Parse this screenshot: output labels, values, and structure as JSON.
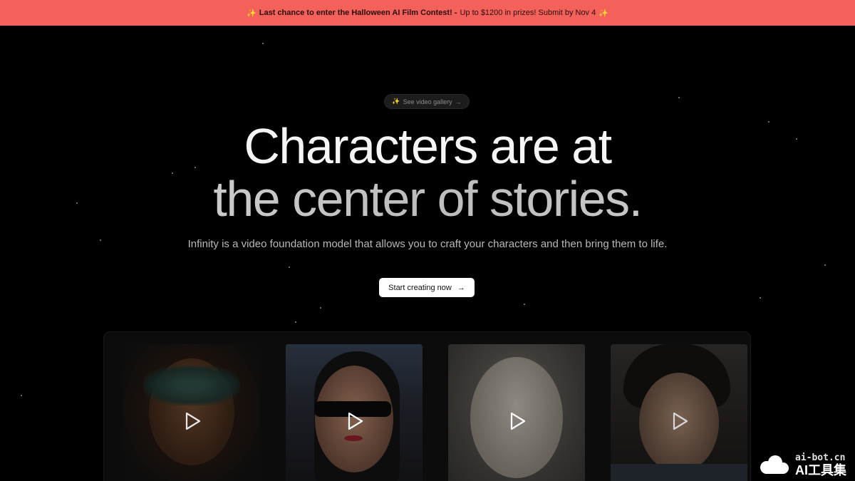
{
  "banner": {
    "bold_text": "Last chance to enter the Halloween AI Film Contest! -",
    "rest_text": "Up to $1200 in prizes! Submit by Nov 4",
    "sparkle": "✨"
  },
  "gallery_pill": {
    "spark": "✨",
    "label": "See video gallery",
    "arrow": "→"
  },
  "hero": {
    "line1": "Characters are at",
    "line2": "the center of stories.",
    "subtitle": "Infinity is a video foundation model that allows you to craft your characters and then bring them to life."
  },
  "cta": {
    "label": "Start creating now",
    "arrow": "→"
  },
  "cards": [
    {
      "icon": "play-icon"
    },
    {
      "icon": "play-icon"
    },
    {
      "icon": "play-icon"
    },
    {
      "icon": "play-icon"
    }
  ],
  "watermark": {
    "top": "ai-bot.cn",
    "bottom": "AI工具集"
  },
  "colors": {
    "banner": "#f4605a",
    "background": "#000000",
    "cta": "#ffffff"
  }
}
